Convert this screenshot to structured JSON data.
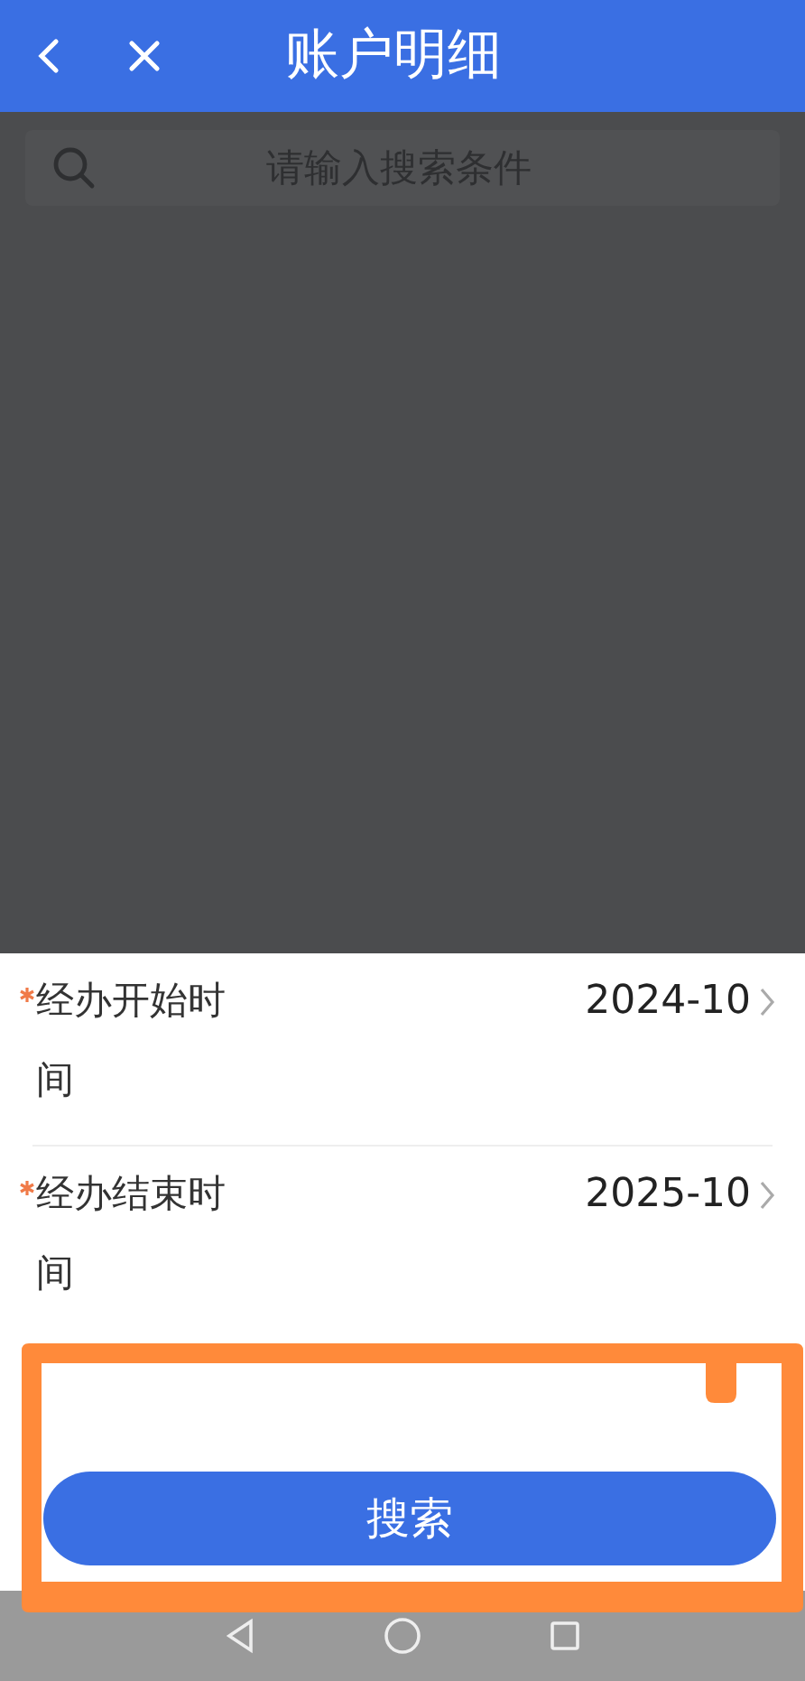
{
  "header": {
    "title": "账户明细"
  },
  "search": {
    "placeholder": "请输入搜索条件"
  },
  "form": {
    "rows": [
      {
        "label": "经办开始时间",
        "value": "2024-10",
        "required": true
      },
      {
        "label": "经办结束时间",
        "value": "2025-10",
        "required": true
      }
    ]
  },
  "search_button": {
    "label": "搜索"
  }
}
